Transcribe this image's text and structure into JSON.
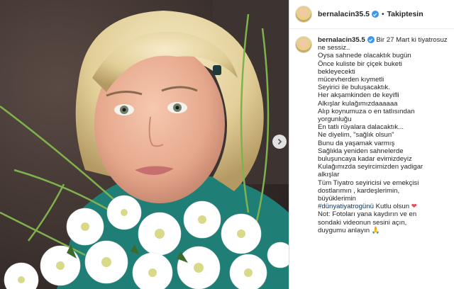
{
  "post": {
    "username": "bernalacin35.5",
    "follow_status": "Takiptesin",
    "separator": "•"
  },
  "caption": {
    "username": "bernalacin35.5",
    "first_line": "Bir 27 Mart ki tiyatrosuz ne sessiz..",
    "lines": [
      "Oysa sahnede olacaktık bugün",
      "Önce kuliste bir çiçek buketi",
      "bekleyecekti",
      "mücevherden kıymetli",
      "Seyirici ile buluşacaktık.",
      "Her akşamkinden de keyifli",
      "Alkışlar kulağımızdaaaaaa",
      "Alıp koynumuza o en tatlısından",
      "yorgunluğu",
      "En tatlı rüyalara dalacaktık...",
      "Ne diyelim, \"sağlık olsun\"",
      "Bunu da yaşamak varmış",
      "Sağlıkla yeniden sahnelerde",
      "buluşuncaya kadar evimizdeyiz",
      "Kulağımızda seyircimizden yadigar",
      "alkışlar",
      "Tüm Tiyatro seyiricisi ve emekçisi",
      "dostlarımın , kardeşlerimin,",
      "büyüklerimin"
    ],
    "hashtag": "#dünyatiyatrogünü",
    "hashtag_suffix": " Kutlu olsun",
    "heart": "❤",
    "note_lines": [
      "Not: Fotoları yana kaydırın ve en",
      "sondaki videonun sesini açın,",
      "duygumu anlayın 🙏"
    ]
  },
  "icons": {
    "verified": "verified-badge-icon",
    "next": "chevron-right-icon"
  },
  "colors": {
    "verified": "#3897f0",
    "hashtag": "#00376b",
    "heart": "#ed4956",
    "text": "#262626"
  }
}
